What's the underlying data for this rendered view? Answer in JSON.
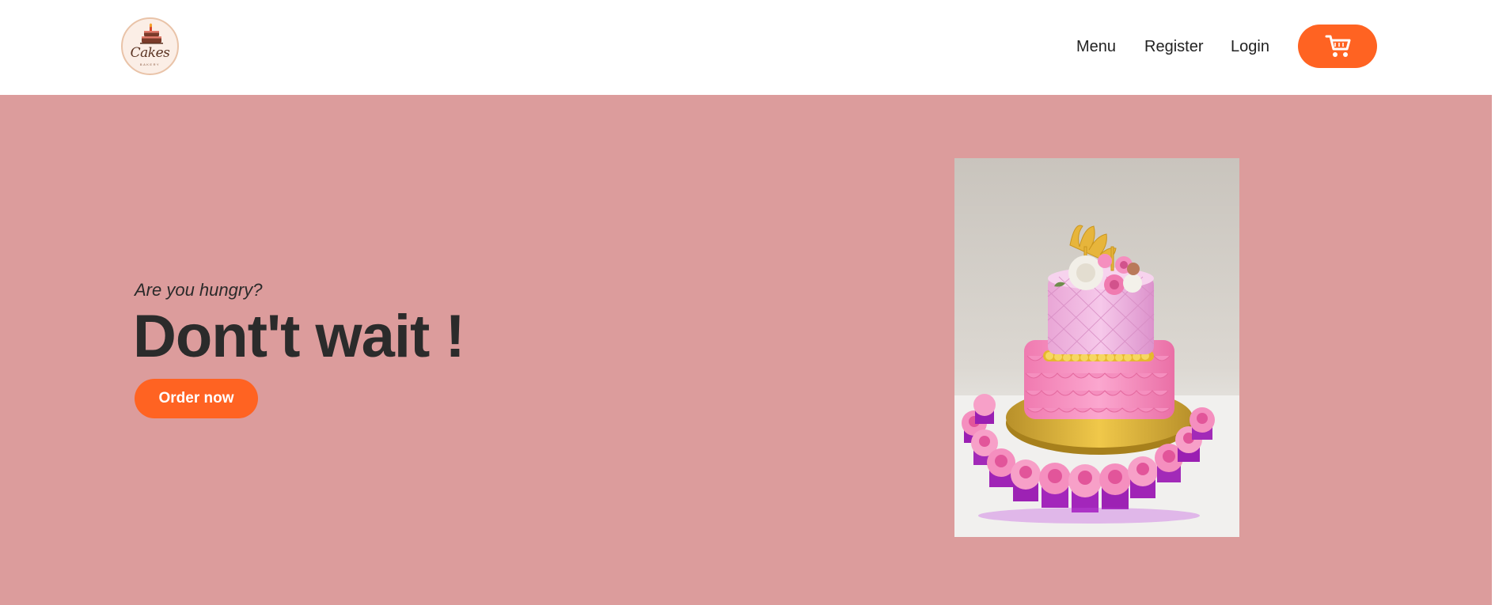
{
  "logo": {
    "icon": "cake-logo-icon",
    "wordmark": "Cakes",
    "subtext": "BAKERY"
  },
  "nav": {
    "items": [
      {
        "label": "Menu"
      },
      {
        "label": "Register"
      },
      {
        "label": "Login"
      }
    ],
    "cart_icon": "shopping-cart-icon"
  },
  "hero": {
    "tagline": "Are you hungry?",
    "headline": "Dont't wait !",
    "cta_label": "Order now",
    "image": "tiered-pink-cake-with-cupcakes"
  },
  "colors": {
    "accent": "#ff6322",
    "hero_background": "#dc9c9c",
    "text_dark": "#2b2b2b",
    "header_background": "#ffffff"
  }
}
